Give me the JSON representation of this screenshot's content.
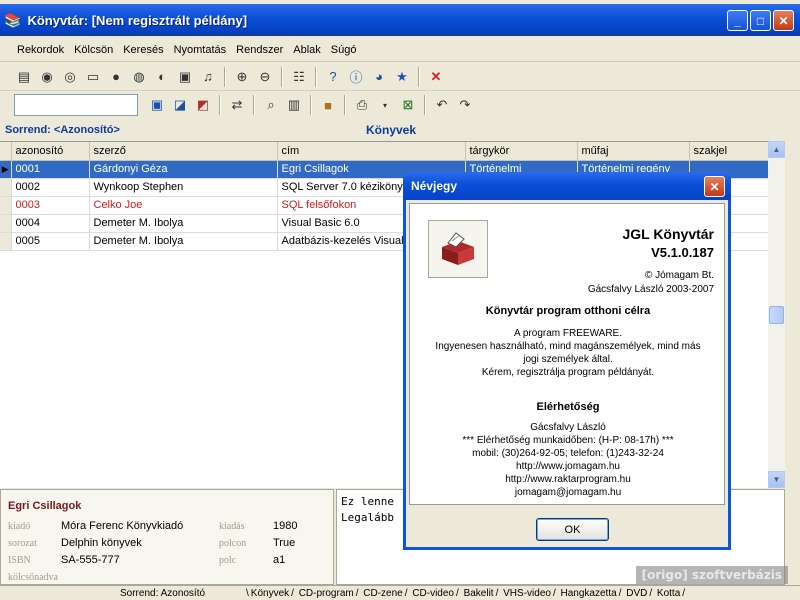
{
  "window": {
    "title": "Könyvtár: [Nem regisztrált példány]"
  },
  "menu": [
    "Rekordok",
    "Kölcsön",
    "Keresés",
    "Nyomtatás",
    "Rendszer",
    "Ablak",
    "Súgó"
  ],
  "sort": {
    "label": "Sorrend: <Azonosító>"
  },
  "grid": {
    "title": "Könyvek",
    "columns": [
      "azonosító",
      "szerző",
      "cím",
      "tárgykör",
      "műfaj",
      "szakjel"
    ],
    "rows": [
      {
        "id": "0001",
        "author": "Gárdonyi Géza",
        "title": "Egri Csillagok",
        "subject": "Történelmi",
        "genre": "Történelmi regény",
        "code": ""
      },
      {
        "id": "0002",
        "author": "Wynkoop Stephen",
        "title": "SQL Server 7.0 kézikönyv",
        "subject": "",
        "genre": "",
        "code": ""
      },
      {
        "id": "0003",
        "author": "Celko Joe",
        "title": "SQL felsőfokon",
        "subject": "",
        "genre": "",
        "code": ""
      },
      {
        "id": "0004",
        "author": "Demeter M. Ibolya",
        "title": "Visual Basic 6.0",
        "subject": "",
        "genre": "",
        "code": ""
      },
      {
        "id": "0005",
        "author": "Demeter M. Ibolya",
        "title": "Adatbázis-kezelés Visual B",
        "subject": "",
        "genre": "",
        "code": ""
      }
    ]
  },
  "detail": {
    "title": "Egri Csillagok",
    "kiado_label": "kiadó",
    "kiado": "Móra Ferenc Könyvkiadó",
    "kiadas_label": "kiadás",
    "kiadas": "1980",
    "sorozat_label": "sorozat",
    "sorozat": "Delphin könyvek",
    "polcon_label": "polcon",
    "polcon": "True",
    "isbn_label": "ISBN",
    "isbn": "SA-555-777",
    "polc_label": "polc",
    "polc": "a1",
    "kolcsonadva_label": "kölcsönadva"
  },
  "memo": [
    "Ez lenne",
    "Legalább"
  ],
  "status": {
    "sort": "Sorrend: Azonosító",
    "tabs": [
      "Könyvek",
      "CD-program",
      "CD-zene",
      "CD-video",
      "Bakelit",
      "VHS-video",
      "Hangkazetta",
      "DVD",
      "Kotta"
    ]
  },
  "watermark": "[origo] szoftverbázis",
  "dialog": {
    "title": "Névjegy",
    "app_name": "JGL Könyvtár",
    "version": "V5.1.0.187",
    "company": "© Jómagam Bt.",
    "author_years": "Gácsfalvy László 2003-2007",
    "tagline": "Könyvtár program otthoni célra",
    "freeware_lines": [
      "A program FREEWARE.",
      "Ingyenesen használható, mind magánszemélyek, mind más",
      "jogi személyek által.",
      "Kérem, regisztrálja program példányát."
    ],
    "contact_title": "Elérhetőség",
    "contact_lines": [
      "Gácsfalvy László",
      "*** Elérhetőség munkaidőben: (H-P: 08-17h) ***",
      "mobil: (30)264-92-05; telefon: (1)243-32-24",
      "http://www.jomagam.hu",
      "http://www.raktarprogram.hu",
      "jomagam@jomagam.hu"
    ],
    "ok_label": "OK"
  }
}
